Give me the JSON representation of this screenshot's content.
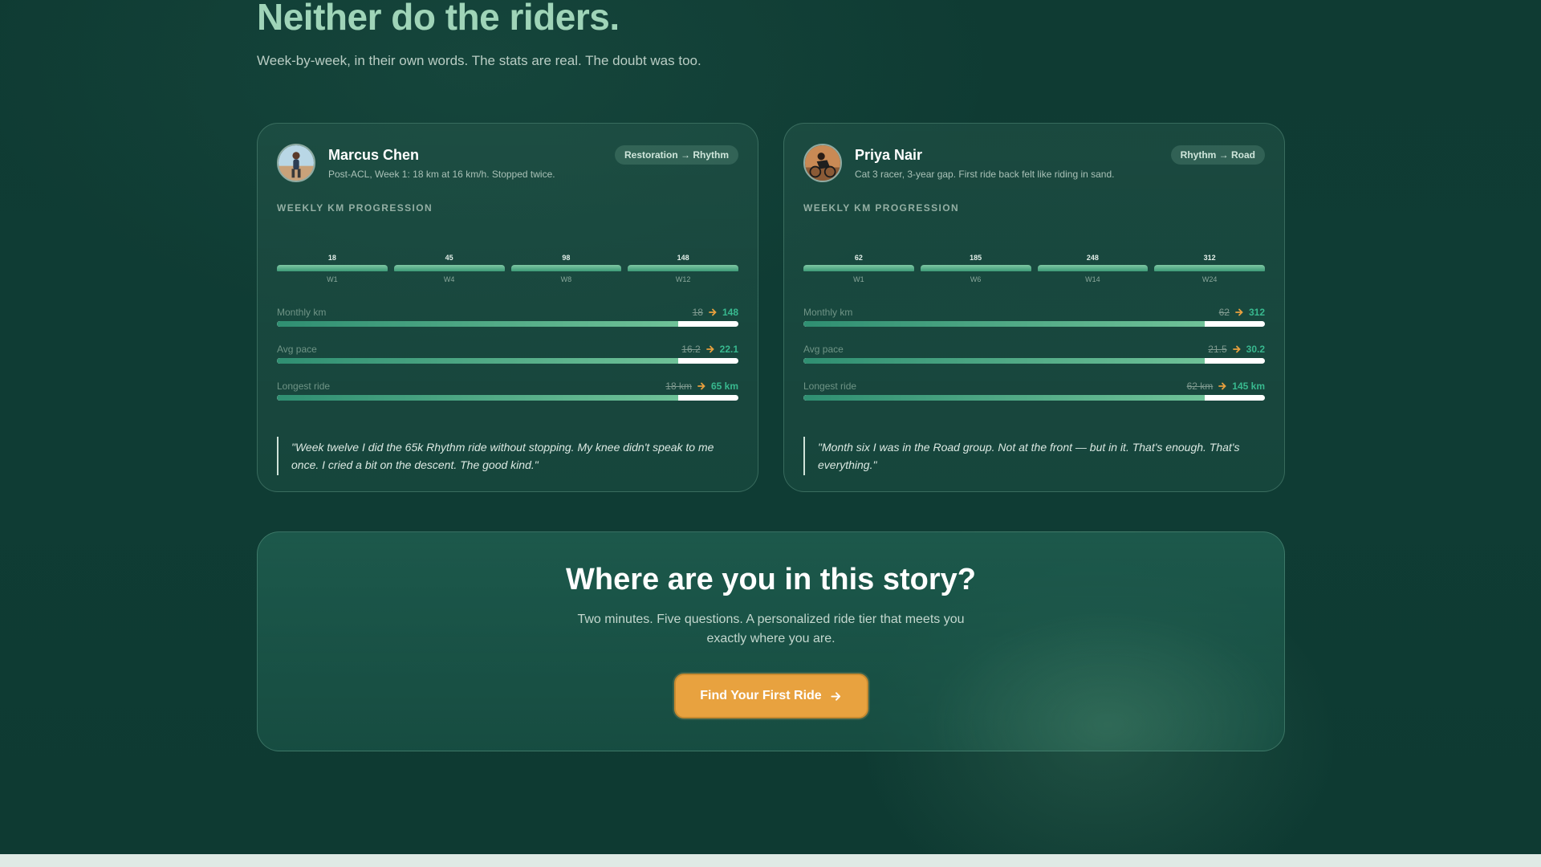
{
  "hero": {
    "title": "Neither do the riders.",
    "subtitle": "Week-by-week, in their own words. The stats are real. The doubt was too."
  },
  "riders": [
    {
      "name": "Marcus Chen",
      "note": "Post-ACL, Week 1: 18 km at 16 km/h. Stopped twice.",
      "tier": "Restoration → Rhythm",
      "section_label": "WEEKLY KM PROGRESSION",
      "weeks": [
        {
          "label": "W1",
          "value": "18"
        },
        {
          "label": "W4",
          "value": "45"
        },
        {
          "label": "W8",
          "value": "98"
        },
        {
          "label": "W12",
          "value": "148"
        }
      ],
      "metrics": [
        {
          "name": "Monthly km",
          "before": "18",
          "after": "148",
          "fill_pct": 87
        },
        {
          "name": "Avg pace",
          "before": "16.2",
          "after": "22.1",
          "fill_pct": 87
        },
        {
          "name": "Longest ride",
          "before": "18 km",
          "after": "65 km",
          "fill_pct": 87
        }
      ],
      "quote": "\"Week twelve I did the 65k Rhythm ride without stopping. My knee didn't speak to me once. I cried a bit on the descent. The good kind.\""
    },
    {
      "name": "Priya Nair",
      "note": "Cat 3 racer, 3-year gap. First ride back felt like riding in sand.",
      "tier": "Rhythm → Road",
      "section_label": "WEEKLY KM PROGRESSION",
      "weeks": [
        {
          "label": "W1",
          "value": "62"
        },
        {
          "label": "W6",
          "value": "185"
        },
        {
          "label": "W14",
          "value": "248"
        },
        {
          "label": "W24",
          "value": "312"
        }
      ],
      "metrics": [
        {
          "name": "Monthly km",
          "before": "62",
          "after": "312",
          "fill_pct": 87
        },
        {
          "name": "Avg pace",
          "before": "21.5",
          "after": "30.2",
          "fill_pct": 87
        },
        {
          "name": "Longest ride",
          "before": "62 km",
          "after": "145 km",
          "fill_pct": 87
        }
      ],
      "quote": "\"Month six I was in the Road group. Not at the front — but in it. That's enough. That's everything.\""
    }
  ],
  "cta": {
    "title": "Where are you in this story?",
    "subtitle": "Two minutes. Five questions. A personalized ride tier that meets you exactly where you are.",
    "button_label": "Find Your First Ride"
  },
  "colors": {
    "background": "#0f3b33",
    "accent": "#e8a23f",
    "positive": "#38b98f",
    "hero_title": "#9fd4b8"
  },
  "icons": {
    "arrow": "arrow-right-icon"
  }
}
